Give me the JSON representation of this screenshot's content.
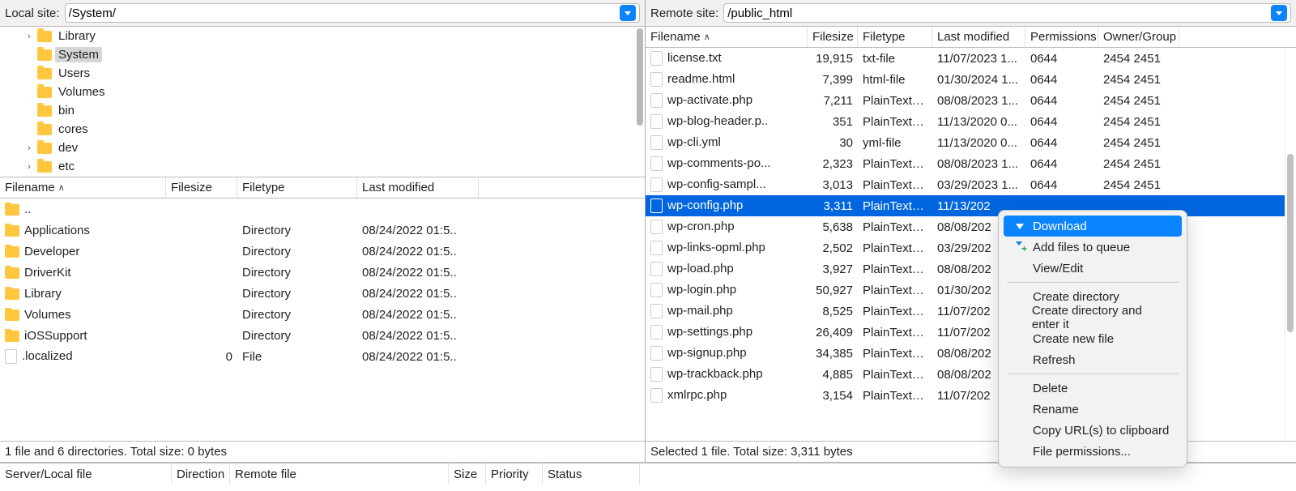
{
  "local": {
    "label": "Local site:",
    "path": "/System/",
    "tree": [
      {
        "name": "Library",
        "expandable": true,
        "selected": false
      },
      {
        "name": "System",
        "expandable": false,
        "selected": true
      },
      {
        "name": "Users",
        "expandable": false,
        "selected": false
      },
      {
        "name": "Volumes",
        "expandable": false,
        "selected": false
      },
      {
        "name": "bin",
        "expandable": false,
        "selected": false
      },
      {
        "name": "cores",
        "expandable": false,
        "selected": false
      },
      {
        "name": "dev",
        "expandable": true,
        "selected": false
      },
      {
        "name": "etc",
        "expandable": true,
        "selected": false
      }
    ],
    "columns": {
      "filename": "Filename",
      "filesize": "Filesize",
      "filetype": "Filetype",
      "last_modified": "Last modified"
    },
    "rows": [
      {
        "icon": "folder",
        "name": "..",
        "size": "",
        "type": "",
        "mod": ""
      },
      {
        "icon": "folder",
        "name": "Applications",
        "size": "",
        "type": "Directory",
        "mod": "08/24/2022 01:5.."
      },
      {
        "icon": "folder",
        "name": "Developer",
        "size": "",
        "type": "Directory",
        "mod": "08/24/2022 01:5.."
      },
      {
        "icon": "folder",
        "name": "DriverKit",
        "size": "",
        "type": "Directory",
        "mod": "08/24/2022 01:5.."
      },
      {
        "icon": "folder",
        "name": "Library",
        "size": "",
        "type": "Directory",
        "mod": "08/24/2022 01:5.."
      },
      {
        "icon": "folder",
        "name": "Volumes",
        "size": "",
        "type": "Directory",
        "mod": "08/24/2022 01:5.."
      },
      {
        "icon": "folder",
        "name": "iOSSupport",
        "size": "",
        "type": "Directory",
        "mod": "08/24/2022 01:5.."
      },
      {
        "icon": "file",
        "name": ".localized",
        "size": "0",
        "type": "File",
        "mod": "08/24/2022 01:5.."
      }
    ],
    "status": "1 file and 6 directories. Total size: 0 bytes"
  },
  "remote": {
    "label": "Remote site:",
    "path": "/public_html",
    "columns": {
      "filename": "Filename",
      "filesize": "Filesize",
      "filetype": "Filetype",
      "last_modified": "Last modified",
      "permissions": "Permissions",
      "owner_group": "Owner/Group"
    },
    "rows": [
      {
        "name": "license.txt",
        "size": "19,915",
        "type": "txt-file",
        "mod": "11/07/2023 1...",
        "perm": "0644",
        "own": "2454 2451"
      },
      {
        "name": "readme.html",
        "size": "7,399",
        "type": "html-file",
        "mod": "01/30/2024 1...",
        "perm": "0644",
        "own": "2454 2451"
      },
      {
        "name": "wp-activate.php",
        "size": "7,211",
        "type": "PlainTextT...",
        "mod": "08/08/2023 1...",
        "perm": "0644",
        "own": "2454 2451"
      },
      {
        "name": "wp-blog-header.p..",
        "size": "351",
        "type": "PlainTextT...",
        "mod": "11/13/2020 0...",
        "perm": "0644",
        "own": "2454 2451"
      },
      {
        "name": "wp-cli.yml",
        "size": "30",
        "type": "yml-file",
        "mod": "11/13/2020 0...",
        "perm": "0644",
        "own": "2454 2451"
      },
      {
        "name": "wp-comments-po...",
        "size": "2,323",
        "type": "PlainTextT...",
        "mod": "08/08/2023 1...",
        "perm": "0644",
        "own": "2454 2451"
      },
      {
        "name": "wp-config-sampl...",
        "size": "3,013",
        "type": "PlainTextT...",
        "mod": "03/29/2023 1...",
        "perm": "0644",
        "own": "2454 2451"
      },
      {
        "name": "wp-config.php",
        "size": "3,311",
        "type": "PlainTextT...",
        "mod": "11/13/202",
        "perm": "",
        "own": "",
        "selected": true
      },
      {
        "name": "wp-cron.php",
        "size": "5,638",
        "type": "PlainTextT...",
        "mod": "08/08/202",
        "perm": "",
        "own": ""
      },
      {
        "name": "wp-links-opml.php",
        "size": "2,502",
        "type": "PlainTextT...",
        "mod": "03/29/202",
        "perm": "",
        "own": ""
      },
      {
        "name": "wp-load.php",
        "size": "3,927",
        "type": "PlainTextT...",
        "mod": "08/08/202",
        "perm": "",
        "own": ""
      },
      {
        "name": "wp-login.php",
        "size": "50,927",
        "type": "PlainTextT...",
        "mod": "01/30/202",
        "perm": "",
        "own": ""
      },
      {
        "name": "wp-mail.php",
        "size": "8,525",
        "type": "PlainTextT...",
        "mod": "11/07/202",
        "perm": "",
        "own": ""
      },
      {
        "name": "wp-settings.php",
        "size": "26,409",
        "type": "PlainTextT...",
        "mod": "11/07/202",
        "perm": "",
        "own": ""
      },
      {
        "name": "wp-signup.php",
        "size": "34,385",
        "type": "PlainTextT...",
        "mod": "08/08/202",
        "perm": "",
        "own": ""
      },
      {
        "name": "wp-trackback.php",
        "size": "4,885",
        "type": "PlainTextT...",
        "mod": "08/08/202",
        "perm": "",
        "own": ""
      },
      {
        "name": "xmlrpc.php",
        "size": "3,154",
        "type": "PlainTextT...",
        "mod": "11/07/202",
        "perm": "",
        "own": ""
      }
    ],
    "status": "Selected 1 file. Total size: 3,311 bytes"
  },
  "queue": {
    "columns": {
      "server_local": "Server/Local file",
      "direction": "Direction",
      "remote_file": "Remote file",
      "size": "Size",
      "priority": "Priority",
      "status": "Status"
    }
  },
  "context_menu": {
    "items": [
      {
        "label": "Download",
        "icon": "download",
        "highlight": true
      },
      {
        "label": "Add files to queue",
        "icon": "queue"
      },
      {
        "label": "View/Edit"
      },
      {
        "sep": true
      },
      {
        "label": "Create directory"
      },
      {
        "label": "Create directory and enter it"
      },
      {
        "label": "Create new file"
      },
      {
        "label": "Refresh"
      },
      {
        "sep": true
      },
      {
        "label": "Delete"
      },
      {
        "label": "Rename"
      },
      {
        "label": "Copy URL(s) to clipboard"
      },
      {
        "label": "File permissions..."
      }
    ]
  }
}
